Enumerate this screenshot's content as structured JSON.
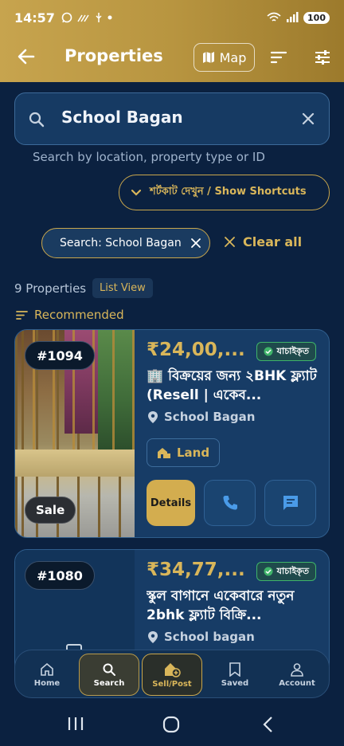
{
  "status": {
    "time": "14:57",
    "battery": "100"
  },
  "appbar": {
    "title": "Properties",
    "map_label": "Map"
  },
  "search": {
    "value": "School Bagan",
    "hint": "Search by location, property type or ID",
    "shortcuts_label": "শর্টকাট দেখুন / Show Shortcuts"
  },
  "filters": {
    "chip_label": "Search: School Bagan",
    "clear_all": "Clear all"
  },
  "results": {
    "count": "9 Properties",
    "view_mode": "List View",
    "sort_label": "Recommended"
  },
  "listings": [
    {
      "id": "#1094",
      "badge": "Sale",
      "price": "₹24,00,...",
      "verified": "যাচাইকৃত",
      "title": "🏢 বিক্রয়ের জন্য ২BHK ফ্ল্যাট (Resell | একেব...",
      "location": "School Bagan",
      "type": "Land",
      "details_label": "Details"
    },
    {
      "id": "#1080",
      "price": "₹34,77,...",
      "verified": "যাচাইকৃত",
      "title": "স্কুল বাগানে একেবারে নতুন 2bhk ফ্ল্যাট বিক্রি...",
      "location": "School bagan"
    }
  ],
  "nav": {
    "home": "Home",
    "search": "Search",
    "post": "Sell/Post",
    "saved": "Saved",
    "account": "Account"
  },
  "colors": {
    "gold": "#d9b65a",
    "navy": "#0b2140",
    "card": "#173c66",
    "verified_green": "#3fb46a"
  }
}
